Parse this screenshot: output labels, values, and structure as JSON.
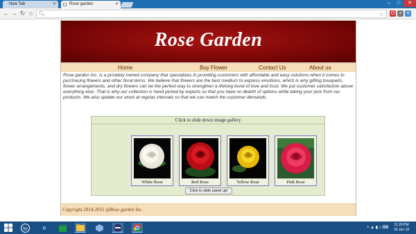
{
  "browser": {
    "tabs": [
      {
        "label": "New Tab",
        "active": false
      },
      {
        "label": "Rose garden",
        "active": true
      }
    ],
    "address": ""
  },
  "site": {
    "title": "Rose Garden",
    "menu": [
      "Home",
      "Buy Flower",
      "Contact Us",
      "About us"
    ],
    "intro": "Rose garden Inc. is a privately owned company that specializes in providing customers with affordable and easy solutions when it comes to purchasing flowers and other floral items. We believe that flowers are the best medium to express emotions, which is why gifting bouquets, flower arrangements, and dry flowers can be the perfect way to strengthen a lifelong bond of love and trust. We put customer satisfaction above everything else. That is why our collection is hand picked by experts so that you have no dearth of options while taking your pick from our products. We also update our stock at regular intervals so that we can match the customer demands.",
    "gallery": {
      "header": "Click to slide down image gallery",
      "items": [
        {
          "caption": "White Rose",
          "color": "#f3f1ea"
        },
        {
          "caption": "Red Rose",
          "color": "#c8101a"
        },
        {
          "caption": "Yellow Rose",
          "color": "#f2c912"
        },
        {
          "caption": "Pink Rose",
          "color": "#e02a52"
        }
      ],
      "slide_up_label": "Click to slide panel up!"
    },
    "footer": "Copyright 2014-2015 @Rose garden Inc."
  },
  "taskbar": {
    "time": "11:20 PM",
    "date": "16-Jun-15"
  }
}
